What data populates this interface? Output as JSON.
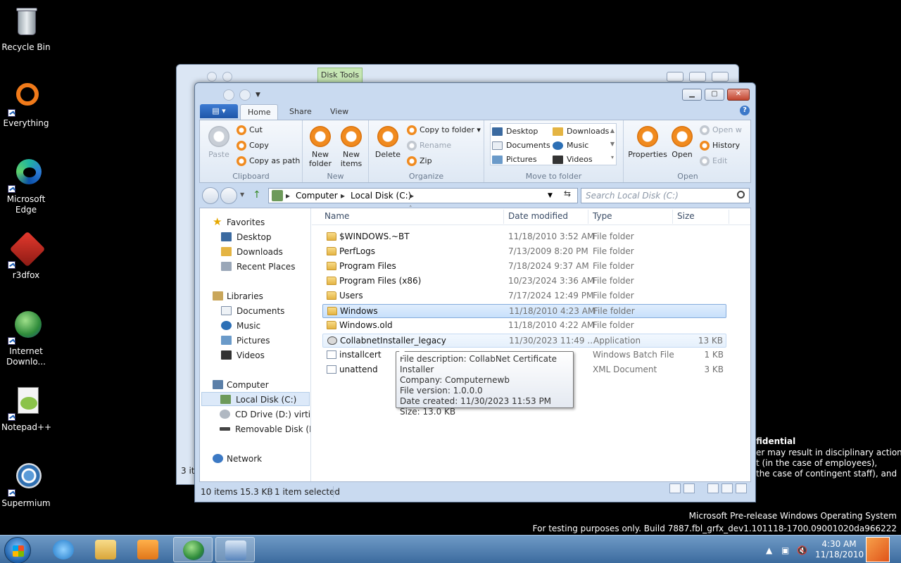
{
  "desktop": {
    "icons": [
      {
        "label": "Recycle Bin",
        "icon": "recycle-bin-icon"
      },
      {
        "label": "Everything",
        "icon": "everything-icon"
      },
      {
        "label": "Microsoft Edge",
        "icon": "edge-icon"
      },
      {
        "label": "r3dfox",
        "icon": "r3dfox-icon"
      },
      {
        "label": "Internet Downlo...",
        "icon": "internet-download-manager-icon"
      },
      {
        "label": "Notepad++",
        "icon": "notepadpp-icon"
      },
      {
        "label": "Supermium",
        "icon": "supermium-icon"
      }
    ],
    "confidential": {
      "title": "fidential",
      "lines": [
        "er may result in disciplinary action up",
        "t (in the case of employees),",
        "the case of contingent staff), and"
      ]
    },
    "build_line1": "Microsoft Pre-release Windows Operating System",
    "build_line2": "For testing purposes only. Build 7887.fbl_grfx_dev1.101118-1700.09001020da966222"
  },
  "background_window": {
    "contextual_tab": "Disk Tools",
    "partial_status": "3 it"
  },
  "window": {
    "ribbon": {
      "tabs": [
        "Home",
        "Share",
        "View"
      ],
      "active_tab": "Home",
      "clipboard": {
        "paste": "Paste",
        "cut": "Cut",
        "copy": "Copy",
        "copy_path": "Copy as path",
        "label": "Clipboard"
      },
      "new": {
        "new_folder": "New folder",
        "new_items": "New items",
        "label": "New"
      },
      "organize": {
        "delete": "Delete",
        "copy_to": "Copy to folder",
        "rename": "Rename",
        "zip": "Zip",
        "label": "Organize"
      },
      "move_to": {
        "items": [
          "Desktop",
          "Downloads",
          "Documents",
          "Music",
          "Pictures",
          "Videos"
        ],
        "label": "Move to folder"
      },
      "open": {
        "properties": "Properties",
        "open": "Open",
        "open_with": "Open w",
        "history": "History",
        "edit": "Edit",
        "label": "Open"
      }
    },
    "address": {
      "segments": [
        "Computer",
        "Local Disk (C:)"
      ],
      "search_placeholder": "Search Local Disk (C:)"
    },
    "nav": {
      "favorites": "Favorites",
      "fav_items": [
        "Desktop",
        "Downloads",
        "Recent Places"
      ],
      "libraries": "Libraries",
      "lib_items": [
        "Documents",
        "Music",
        "Pictures",
        "Videos"
      ],
      "computer": "Computer",
      "comp_items": [
        "Local Disk (C:)",
        "CD Drive (D:) virtio-w",
        "Removable Disk (E:)"
      ],
      "network": "Network",
      "selected": "Local Disk (C:)"
    },
    "columns": {
      "name": "Name",
      "date": "Date modified",
      "type": "Type",
      "size": "Size"
    },
    "files": [
      {
        "name": "$WINDOWS.~BT",
        "date": "11/18/2010 3:52 AM",
        "type": "File folder",
        "size": "",
        "kind": "folder"
      },
      {
        "name": "PerfLogs",
        "date": "7/13/2009 8:20 PM",
        "type": "File folder",
        "size": "",
        "kind": "folder"
      },
      {
        "name": "Program Files",
        "date": "7/18/2024 9:37 AM",
        "type": "File folder",
        "size": "",
        "kind": "folder"
      },
      {
        "name": "Program Files (x86)",
        "date": "10/23/2024 3:36 AM",
        "type": "File folder",
        "size": "",
        "kind": "folder"
      },
      {
        "name": "Users",
        "date": "7/17/2024 12:49 PM",
        "type": "File folder",
        "size": "",
        "kind": "folder"
      },
      {
        "name": "Windows",
        "date": "11/18/2010 4:23 AM",
        "type": "File folder",
        "size": "",
        "kind": "folder"
      },
      {
        "name": "Windows.old",
        "date": "11/18/2010 4:22 AM",
        "type": "File folder",
        "size": "",
        "kind": "folder"
      },
      {
        "name": "CollabnetInstaller_legacy",
        "date": "11/30/2023 11:49 ...",
        "type": "Application",
        "size": "13 KB",
        "kind": "app"
      },
      {
        "name": "installcert",
        "date": "",
        "type": "Windows Batch File",
        "size": "1 KB",
        "kind": "doc"
      },
      {
        "name": "unattend",
        "date": "",
        "type": "XML Document",
        "size": "3 KB",
        "kind": "doc"
      }
    ],
    "selected_file": "Windows",
    "hovered_file": "CollabnetInstaller_legacy",
    "tooltip": [
      "File description: CollabNet Certificate Installer",
      "Company: Computernewb",
      "File version: 1.0.0.0",
      "Date created: 11/30/2023 11:53 PM",
      "Size: 13.0 KB"
    ],
    "status": {
      "items": "10 items",
      "size": "15.3 KB",
      "selected": "1 item selected"
    }
  },
  "taskbar": {
    "apps": [
      "internet-explorer-icon",
      "file-explorer-icon",
      "media-player-icon",
      "internet-download-manager-icon",
      "remote-desktop-icon"
    ],
    "time": "4:30 AM",
    "date": "11/18/2010"
  }
}
